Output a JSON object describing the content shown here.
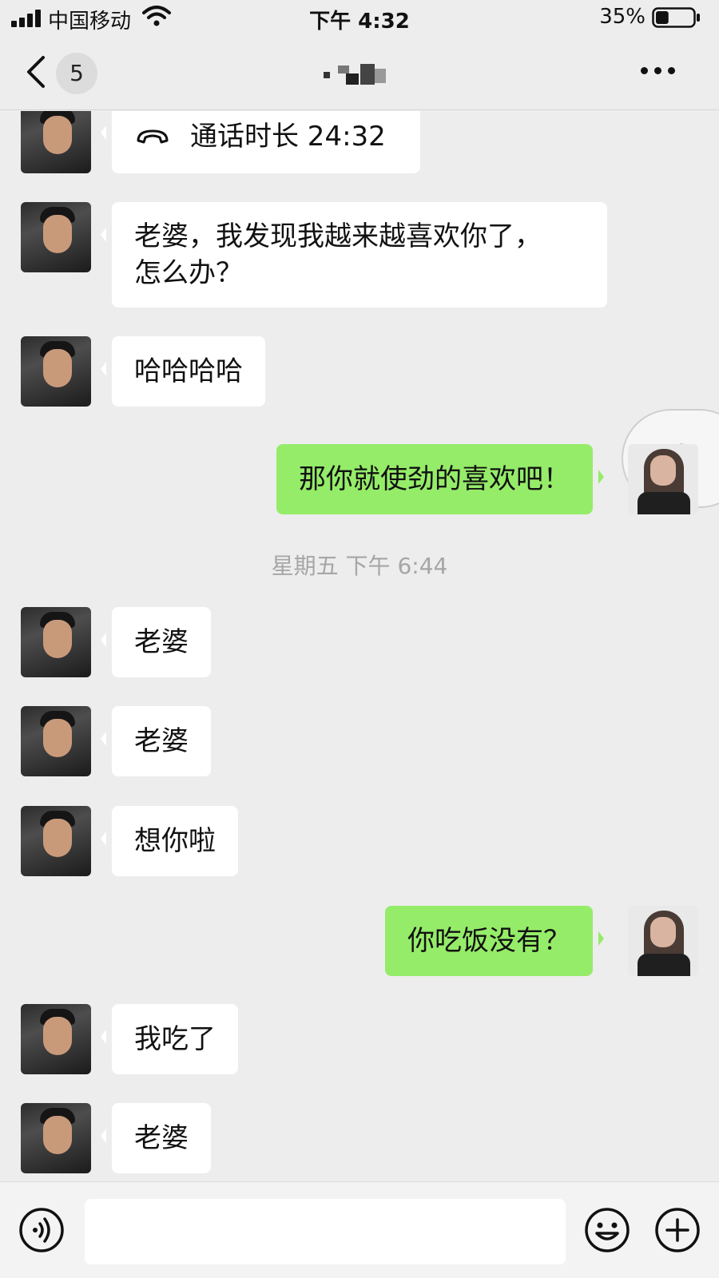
{
  "status": {
    "carrier": "中国移动",
    "time": "下午 4:32",
    "battery": "35%",
    "battery_level": 0.35
  },
  "nav": {
    "unread_count": "5"
  },
  "messages": {
    "m1": {
      "text": "通话时长 24:32",
      "icon": "hangup-icon"
    },
    "m2": {
      "line1": " 老婆，我发现我越来越喜欢你了，",
      "line2": "怎么办？"
    },
    "m3": {
      "text": "哈哈哈哈"
    },
    "m4": {
      "text": "那你就使劲的喜欢吧！"
    },
    "timestamp": "星期五 下午 6:44",
    "m5": {
      "text": "老婆"
    },
    "m6": {
      "text": "老婆"
    },
    "m7": {
      "text": "想你啦"
    },
    "m8": {
      "text": "你吃饭没有？"
    },
    "m9": {
      "text": "我吃了"
    },
    "m10": {
      "text": "老婆"
    }
  },
  "input": {
    "value": ""
  },
  "icons": [
    "back-icon",
    "more-icon",
    "link-icon",
    "voice-icon",
    "emoji-icon",
    "plus-icon",
    "hangup-icon",
    "signal-icon",
    "wifi-icon",
    "battery-icon"
  ]
}
